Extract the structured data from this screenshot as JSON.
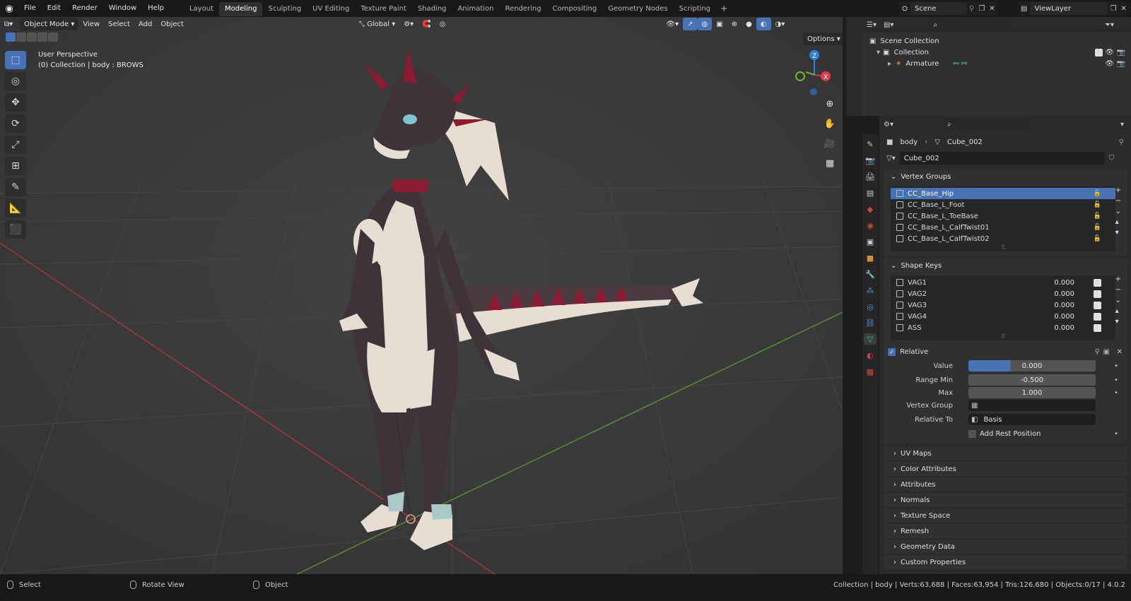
{
  "topbar": {
    "menus": [
      "File",
      "Edit",
      "Render",
      "Window",
      "Help"
    ],
    "workspaces": [
      "Layout",
      "Modeling",
      "Sculpting",
      "UV Editing",
      "Texture Paint",
      "Shading",
      "Animation",
      "Rendering",
      "Compositing",
      "Geometry Nodes",
      "Scripting"
    ],
    "active_workspace": "Modeling",
    "scene": "Scene",
    "view_layer": "ViewLayer"
  },
  "viewport": {
    "mode": "Object Mode",
    "menus": [
      "View",
      "Select",
      "Add",
      "Object"
    ],
    "orientation": "Global",
    "options_label": "Options",
    "info_line1": "User Perspective",
    "info_line2": "(0) Collection | body : BROWS",
    "gizmo": {
      "z": "Z",
      "x": "X"
    }
  },
  "outliner": {
    "scene_collection": "Scene Collection",
    "collection": "Collection",
    "armature": "Armature"
  },
  "properties": {
    "object": "body",
    "mesh": "Cube_002",
    "mesh_field": "Cube_002",
    "vertex_groups_title": "Vertex Groups",
    "vertex_groups": [
      "CC_Base_Hip",
      "CC_Base_L_Foot",
      "CC_Base_L_ToeBase",
      "CC_Base_L_CalfTwist01",
      "CC_Base_L_CalfTwist02"
    ],
    "shape_keys_title": "Shape Keys",
    "shape_keys": [
      {
        "name": "VAG1",
        "value": "0.000"
      },
      {
        "name": "VAG2",
        "value": "0.000"
      },
      {
        "name": "VAG3",
        "value": "0.000"
      },
      {
        "name": "VAG4",
        "value": "0.000"
      },
      {
        "name": "ASS",
        "value": "0.000"
      }
    ],
    "relative_label": "Relative",
    "value_label": "Value",
    "value": "0.000",
    "range_min_label": "Range Min",
    "range_min": "-0.500",
    "max_label": "Max",
    "max": "1.000",
    "vertex_group_label": "Vertex Group",
    "relative_to_label": "Relative To",
    "relative_to": "Basis",
    "add_rest_label": "Add Rest Position",
    "collapsed_panels": [
      "UV Maps",
      "Color Attributes",
      "Attributes",
      "Normals",
      "Texture Space",
      "Remesh",
      "Geometry Data",
      "Custom Properties"
    ]
  },
  "statusbar": {
    "select": "Select",
    "rotate": "Rotate View",
    "object": "Object",
    "stats": "Collection | body | Verts:63,688 | Faces:63,954 | Tris:126,680 | Objects:0/17 | 4.0.2"
  },
  "colors": {
    "accent": "#4772b3",
    "x_axis": "#d83b4b",
    "y_axis": "#7cb23a",
    "z_axis": "#2e7fd6"
  }
}
